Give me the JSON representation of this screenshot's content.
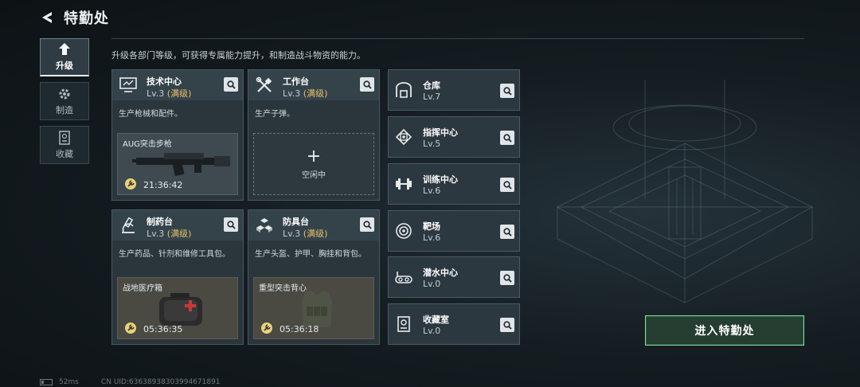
{
  "header": {
    "title": "特勤处",
    "back_icon": "back-arrow-icon"
  },
  "side_tabs": [
    {
      "label": "升级",
      "icon": "upgrade-icon",
      "active": true
    },
    {
      "label": "制造",
      "icon": "gear-icon",
      "active": false
    },
    {
      "label": "收藏",
      "icon": "collection-icon",
      "active": false
    }
  ],
  "subtitle": "升级各部门等级，可获得专属能力提升，和制造战斗物资的能力。",
  "workshops": [
    {
      "name": "技术中心",
      "level": "Lv.3",
      "maxed": "(满级)",
      "desc": "生产枪械和配件。",
      "product": "AUG突击步枪",
      "time": "21:36:42"
    },
    {
      "name": "工作台",
      "level": "Lv.3",
      "maxed": "(满级)",
      "desc": "生产子弹。",
      "idle_plus": "+",
      "idle_text": "空闲中"
    },
    {
      "name": "制药台",
      "level": "Lv.3",
      "maxed": "(满级)",
      "desc": "生产药品、针剂和维修工具包。",
      "product": "战地医疗箱",
      "time": "05:36:35"
    },
    {
      "name": "防具台",
      "level": "Lv.3",
      "maxed": "(满级)",
      "desc": "生产头盔、护甲、胸挂和背包。",
      "product": "重型突击背心",
      "time": "05:36:18"
    }
  ],
  "facilities": [
    {
      "name": "仓库",
      "level": "Lv.7",
      "icon": "warehouse-icon"
    },
    {
      "name": "指挥中心",
      "level": "Lv.5",
      "icon": "command-chip-icon"
    },
    {
      "name": "训练中心",
      "level": "Lv.6",
      "icon": "dumbbell-icon"
    },
    {
      "name": "靶场",
      "level": "Lv.6",
      "icon": "target-icon"
    },
    {
      "name": "潜水中心",
      "level": "Lv.0",
      "icon": "diving-icon"
    },
    {
      "name": "收藏室",
      "level": "Lv.0",
      "icon": "collection-room-icon"
    }
  ],
  "enter_button": "进入特勤处",
  "footer": {
    "ping": "52ms",
    "uid": "CN UID:636389383039946718​91"
  },
  "colors": {
    "accent_green": "#7fdf9a",
    "maxed_gold": "#e7c266"
  }
}
